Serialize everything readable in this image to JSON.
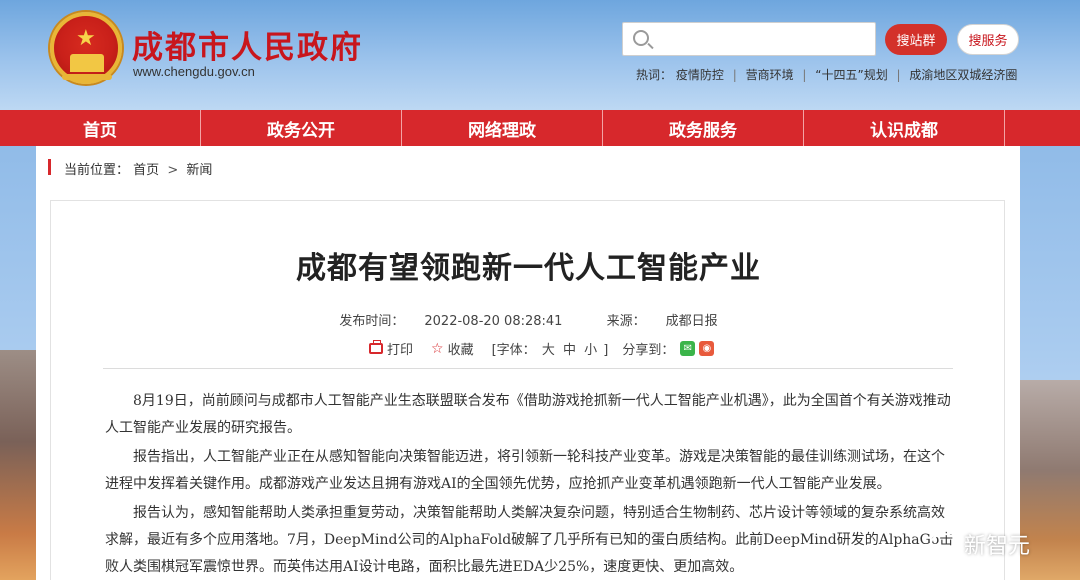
{
  "header": {
    "site_title": "成都市人民政府",
    "site_url": "www.chengdu.gov.cn",
    "search_placeholder": "",
    "search_site_button": "搜站群",
    "search_service_button": "搜服务",
    "hotwords_label": "热词：",
    "hotwords": [
      "疫情防控",
      "营商环境",
      "“十四五”规划",
      "成渝地区双城经济圈"
    ]
  },
  "nav": {
    "items": [
      "首页",
      "政务公开",
      "网络理政",
      "政务服务",
      "认识成都"
    ]
  },
  "breadcrumb": {
    "label": "当前位置：",
    "home": "首页",
    "separator": ">",
    "current": "新闻"
  },
  "article": {
    "title": "成都有望领跑新一代人工智能产业",
    "publish_label": "发布时间：",
    "publish_time": "2022-08-20 08:28:41",
    "source_label": "来源：",
    "source": "成都日报",
    "print_label": "打印",
    "favorite_label": "收藏",
    "font_label": "[字体：",
    "font_sizes": [
      "大",
      "中",
      "小"
    ],
    "font_close": "]",
    "share_label": "分享到：",
    "paragraphs": [
      "8月19日，尚前顾问与成都市人工智能产业生态联盟联合发布《借助游戏抢抓新一代人工智能产业机遇》，此为全国首个有关游戏推动人工智能产业发展的研究报告。",
      "报告指出，人工智能产业正在从感知智能向决策智能迈进，将引领新一轮科技产业变革。游戏是决策智能的最佳训练测试场，在这个进程中发挥着关键作用。成都游戏产业发达且拥有游戏AI的全国领先优势，应抢抓产业变革机遇领跑新一代人工智能产业发展。",
      "报告认为，感知智能帮助人类承担重复劳动，决策智能帮助人类解决复杂问题，特别适合生物制药、芯片设计等领域的复杂系统高效求解，最近有多个应用落地。7月，DeepMind公司的AlphaFold破解了几乎所有已知的蛋白质结构。此前DeepMind研发的AlphaGo击败人类围棋冠军震惊世界。而英伟达用AI设计电路，面积比最先进EDA少25%，速度更快、更加高效。"
    ]
  },
  "watermark": {
    "text": "新智元"
  },
  "colors": {
    "brand_red": "#d7282c",
    "title_red": "#c8161d"
  }
}
